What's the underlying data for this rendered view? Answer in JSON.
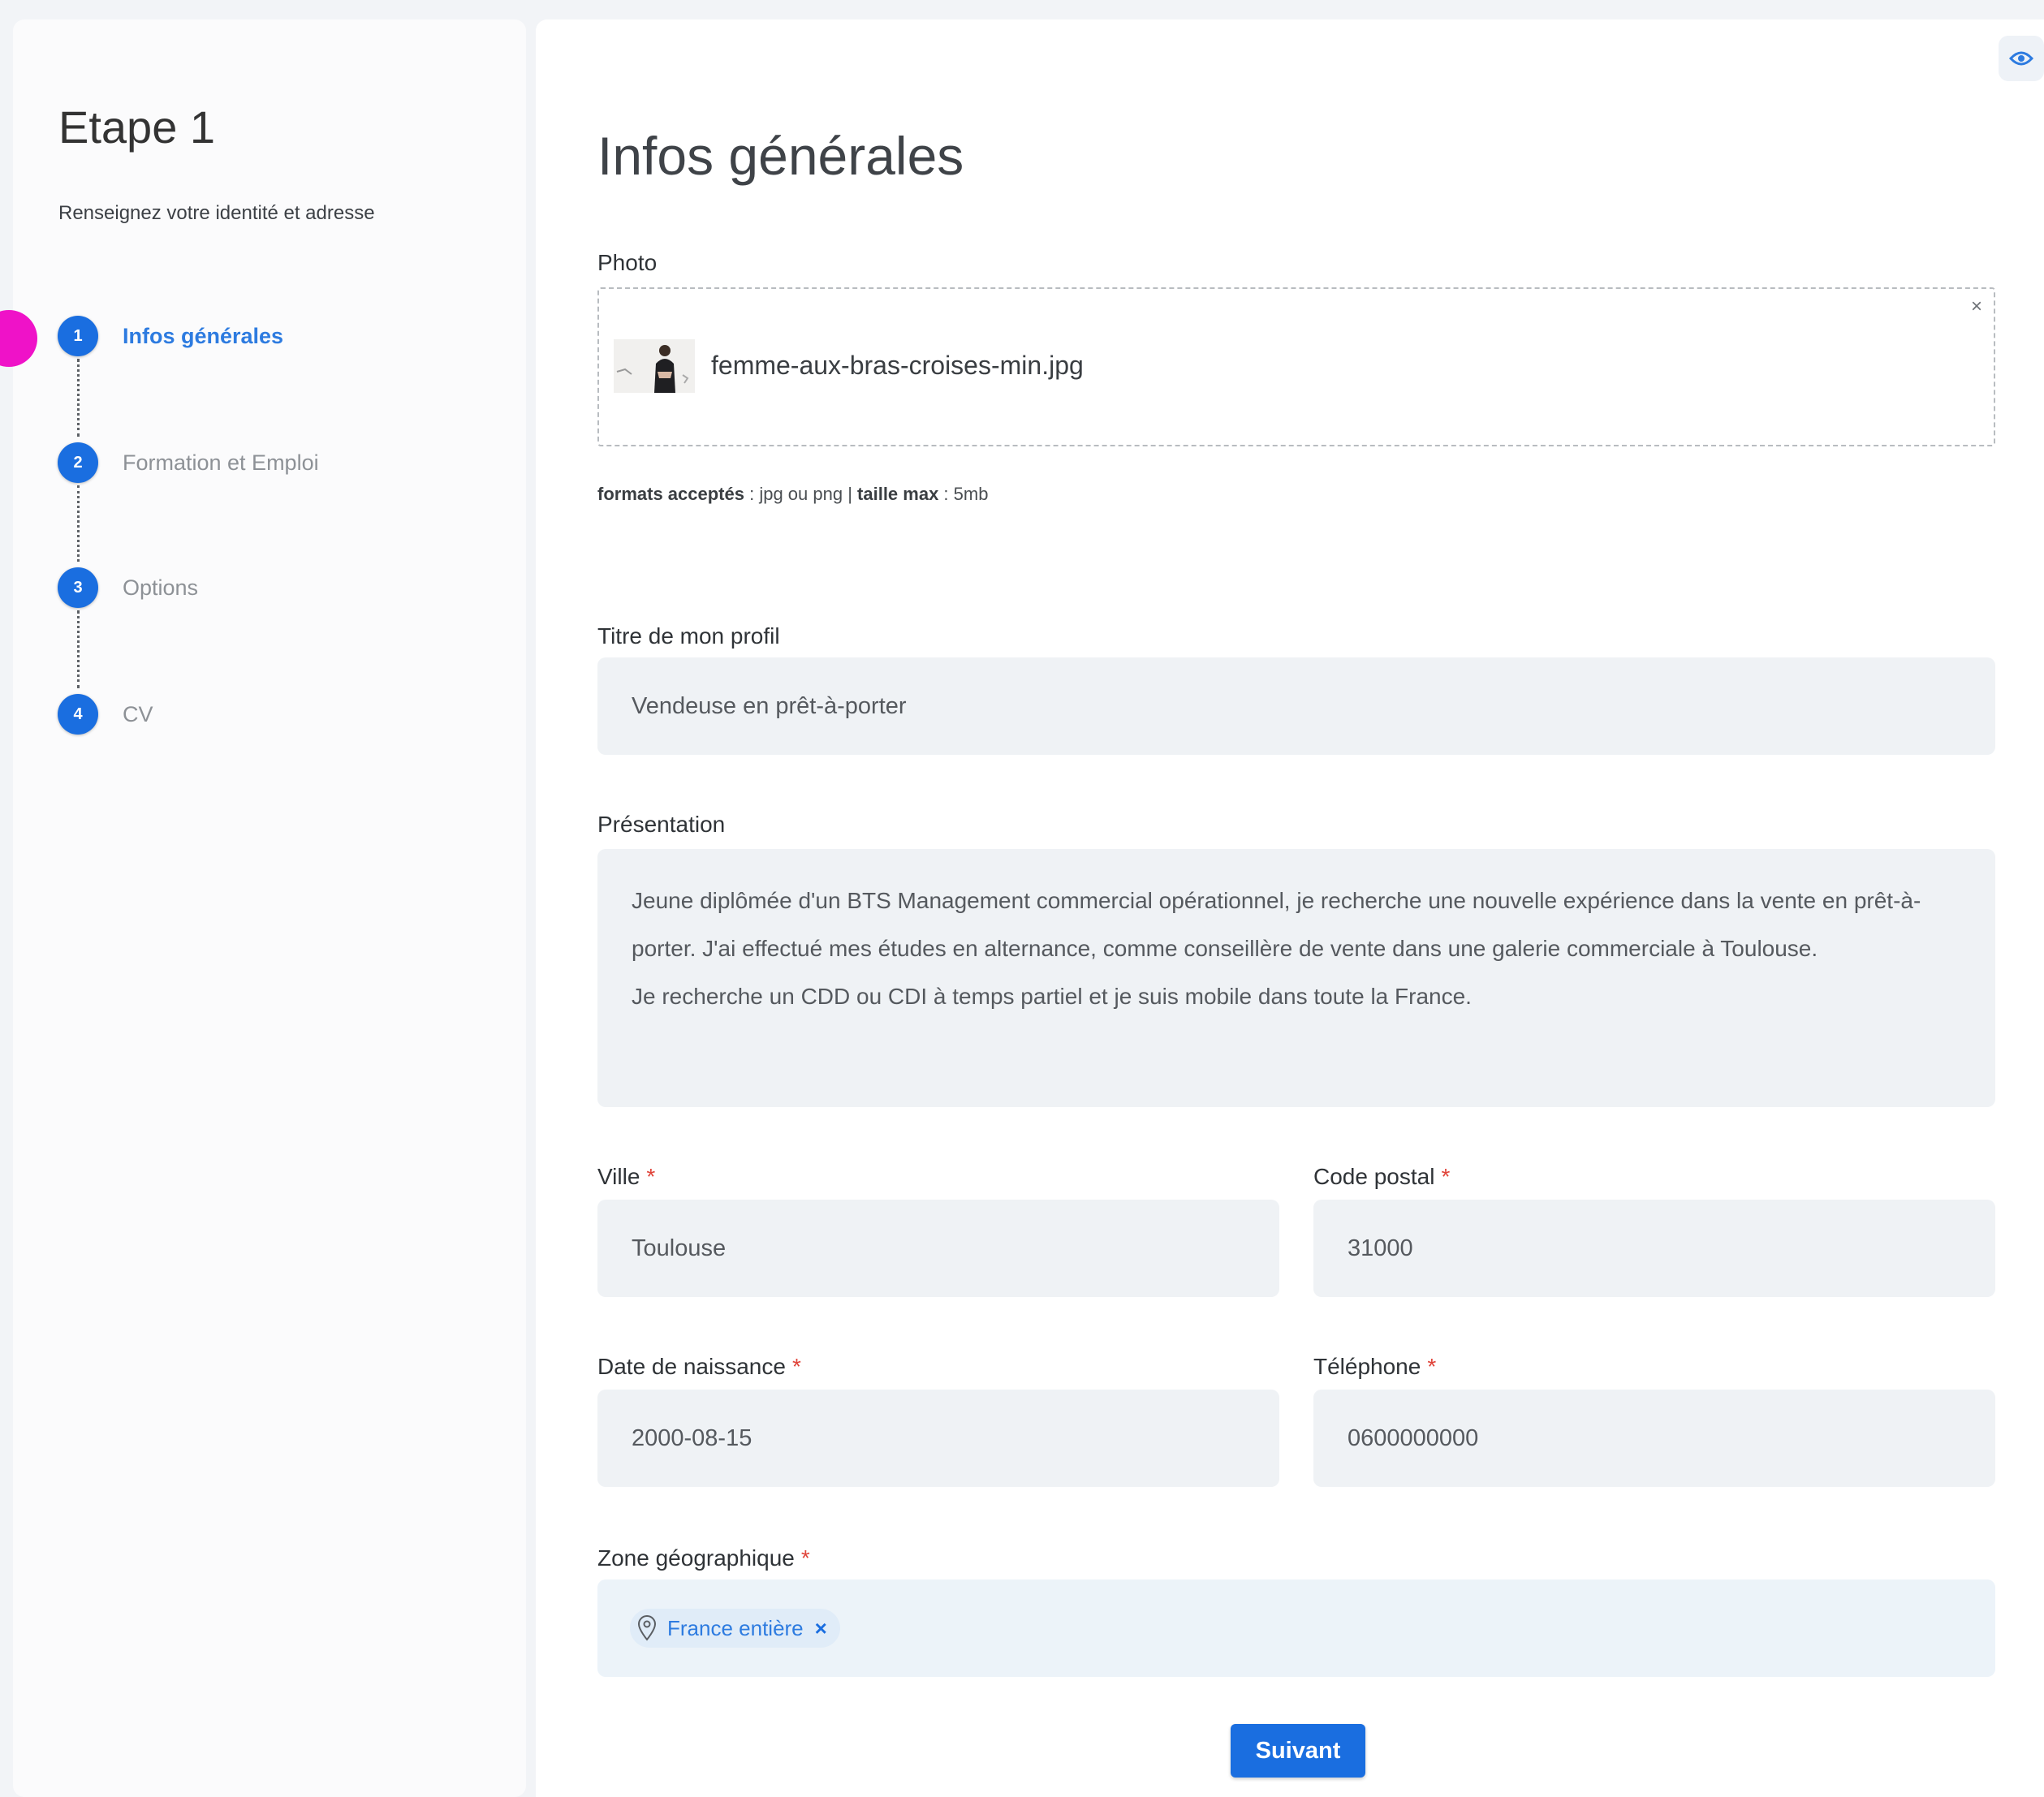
{
  "sidebar": {
    "title": "Etape 1",
    "subtitle": "Renseignez votre identité et adresse",
    "steps": [
      {
        "num": "1",
        "label": "Infos générales",
        "active": true
      },
      {
        "num": "2",
        "label": "Formation et Emploi",
        "active": false
      },
      {
        "num": "3",
        "label": "Options",
        "active": false
      },
      {
        "num": "4",
        "label": "CV",
        "active": false
      }
    ]
  },
  "main": {
    "title": "Infos générales",
    "preview_icon": "eye-icon",
    "photo": {
      "label": "Photo",
      "file_name": "femme-aux-bras-croises-min.jpg",
      "remove_symbol": "×",
      "formats_label": "formats acceptés",
      "formats_value": " : jpg ou png | ",
      "max_label": "taille max",
      "max_value": " : 5mb"
    },
    "profile_title": {
      "label": "Titre de mon profil",
      "value": "Vendeuse en prêt-à-porter"
    },
    "presentation": {
      "label": "Présentation",
      "line1": "Jeune diplômée d'un BTS Management commercial opérationnel, je recherche une nouvelle expérience dans la vente en prêt-à-porter. J'ai effectué mes études en alternance, comme conseillère de vente dans une galerie commerciale à Toulouse.",
      "line2": "Je recherche un CDD ou CDI à temps partiel et je suis mobile dans toute la France."
    },
    "city": {
      "label": "Ville",
      "value": "Toulouse"
    },
    "postal_code": {
      "label": "Code postal",
      "value": "31000"
    },
    "birth_date": {
      "label": "Date de naissance",
      "value": "2000-08-15"
    },
    "phone": {
      "label": "Téléphone",
      "value": "0600000000"
    },
    "zone": {
      "label": "Zone géographique",
      "chip": "France entière",
      "chip_remove": "×"
    },
    "required_mark": "*",
    "next_button": "Suivant"
  },
  "colors": {
    "accent": "#1a6ee0",
    "required": "#e0443a",
    "input_bg": "#eff2f5",
    "chip_bg": "#e0ecf8"
  }
}
